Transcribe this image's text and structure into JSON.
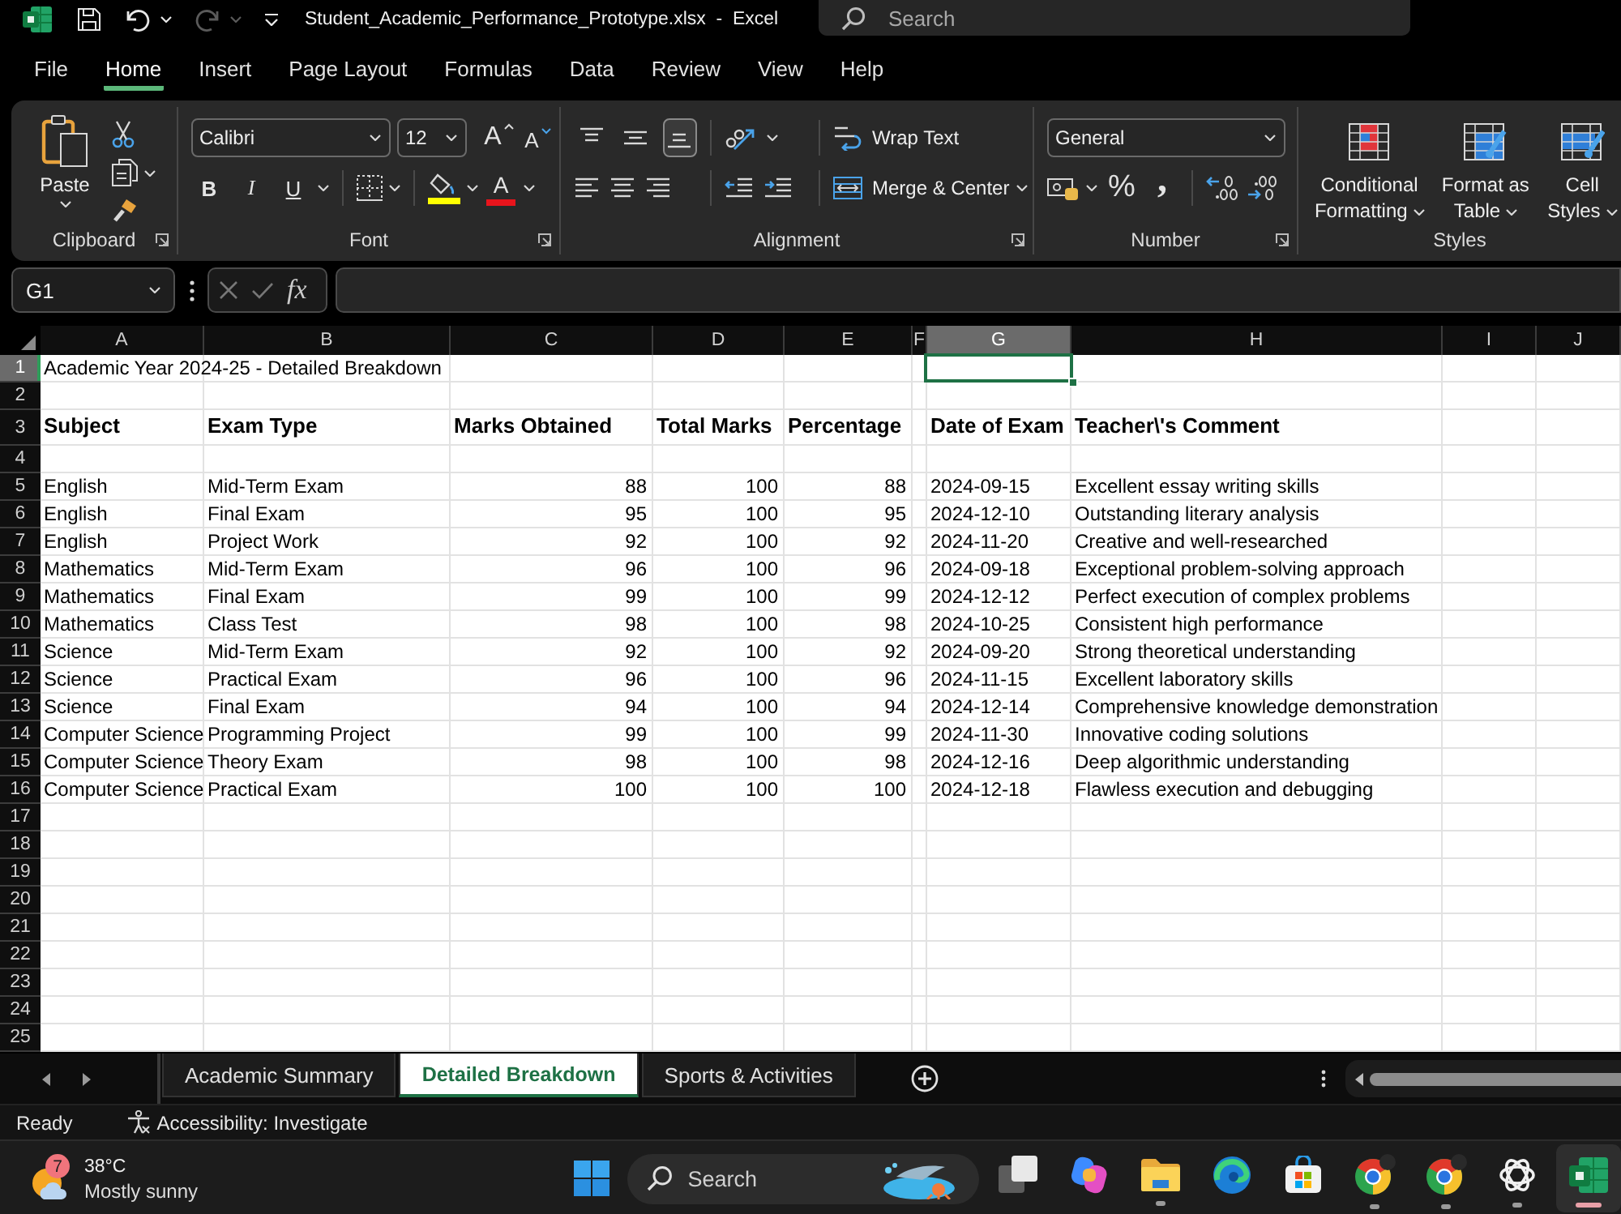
{
  "title_bar": {
    "quick_access": [
      {
        "kind": "save",
        "disabled": false
      },
      {
        "kind": "undo",
        "disabled": false
      },
      {
        "kind": "redo",
        "disabled": true
      },
      {
        "kind": "customize",
        "disabled": false
      }
    ],
    "title": "Student_Academic_Performance_Prototype.xlsx  -  Excel",
    "search": {
      "placeholder": "Search"
    }
  },
  "menu_tabs": [
    {
      "label": "File",
      "selected": false
    },
    {
      "label": "Home",
      "selected": true
    },
    {
      "label": "Insert",
      "selected": false
    },
    {
      "label": "Page Layout",
      "selected": false
    },
    {
      "label": "Formulas",
      "selected": false
    },
    {
      "label": "Data",
      "selected": false
    },
    {
      "label": "Review",
      "selected": false
    },
    {
      "label": "View",
      "selected": false
    },
    {
      "label": "Help",
      "selected": false
    }
  ],
  "ribbon": {
    "clipboard": {
      "label": "Clipboard",
      "paste": "Paste"
    },
    "font": {
      "label": "Font",
      "font_name": "Calibri",
      "font_size": "12",
      "grow_font": "A",
      "shrink_font": "A",
      "style_buttons": [
        {
          "kind": "bold",
          "glyph": "B"
        },
        {
          "kind": "italic",
          "glyph": "I"
        },
        {
          "kind": "underline",
          "glyph": "U"
        }
      ],
      "font_color": "A"
    },
    "alignment": {
      "label": "Alignment",
      "vertical": [
        {
          "kind": "top",
          "selected": false
        },
        {
          "kind": "middle",
          "selected": false
        },
        {
          "kind": "bottom",
          "selected": true
        }
      ],
      "wrap_text": "Wrap Text",
      "merge_center": "Merge & Center"
    },
    "number": {
      "label": "Number",
      "format": "General",
      "percent": "%",
      "comma": ","
    },
    "styles": {
      "label": "Styles",
      "buttons": [
        {
          "kind": "conditional",
          "label": "Conditional Formatting"
        },
        {
          "kind": "table",
          "label": "Format as Table"
        },
        {
          "kind": "cell",
          "label": "Cell Styles"
        }
      ]
    }
  },
  "formula_bar": {
    "name_box": "G1",
    "function": "fx"
  },
  "sheet": {
    "columns": [
      {
        "label": "A",
        "kind": "text",
        "selected": false
      },
      {
        "label": "B",
        "kind": "text",
        "selected": false
      },
      {
        "label": "C",
        "kind": "number",
        "selected": false
      },
      {
        "label": "D",
        "kind": "number",
        "selected": false
      },
      {
        "label": "E",
        "kind": "number",
        "selected": false
      },
      {
        "label": "F",
        "kind": "text",
        "selected": false
      },
      {
        "label": "G",
        "kind": "text",
        "selected": true
      },
      {
        "label": "H",
        "kind": "text",
        "selected": false
      },
      {
        "label": "I",
        "kind": "text",
        "selected": false
      },
      {
        "label": "J",
        "kind": "text",
        "selected": false
      }
    ],
    "rows": [
      {
        "number": "1",
        "kind": "title",
        "selected": true,
        "cells": [
          "Academic Year 2024-25 - Detailed Breakdown"
        ]
      },
      {
        "number": "2",
        "kind": "blank",
        "selected": false
      },
      {
        "number": "3",
        "kind": "header",
        "selected": false,
        "cells": [
          "Subject",
          "Exam Type",
          "Marks Obtained",
          "Total Marks",
          "Percentage",
          null,
          "Date of Exam",
          "Teacher\\'s Comment"
        ]
      },
      {
        "number": "4",
        "kind": "blank",
        "selected": false
      },
      {
        "number": "5",
        "kind": "data",
        "selected": false,
        "cells": [
          "English",
          "Mid-Term Exam",
          "88",
          "100",
          "88",
          null,
          "2024-09-15",
          "Excellent essay writing skills"
        ]
      },
      {
        "number": "6",
        "kind": "data",
        "selected": false,
        "cells": [
          "English",
          "Final Exam",
          "95",
          "100",
          "95",
          null,
          "2024-12-10",
          "Outstanding literary analysis"
        ]
      },
      {
        "number": "7",
        "kind": "data",
        "selected": false,
        "cells": [
          "English",
          "Project Work",
          "92",
          "100",
          "92",
          null,
          "2024-11-20",
          "Creative and well-researched"
        ]
      },
      {
        "number": "8",
        "kind": "data",
        "selected": false,
        "cells": [
          "Mathematics",
          "Mid-Term Exam",
          "96",
          "100",
          "96",
          null,
          "2024-09-18",
          "Exceptional problem-solving approach"
        ]
      },
      {
        "number": "9",
        "kind": "data",
        "selected": false,
        "cells": [
          "Mathematics",
          "Final Exam",
          "99",
          "100",
          "99",
          null,
          "2024-12-12",
          "Perfect execution of complex problems"
        ]
      },
      {
        "number": "10",
        "kind": "data",
        "selected": false,
        "cells": [
          "Mathematics",
          "Class Test",
          "98",
          "100",
          "98",
          null,
          "2024-10-25",
          "Consistent high performance"
        ]
      },
      {
        "number": "11",
        "kind": "data",
        "selected": false,
        "cells": [
          "Science",
          "Mid-Term Exam",
          "92",
          "100",
          "92",
          null,
          "2024-09-20",
          "Strong theoretical understanding"
        ]
      },
      {
        "number": "12",
        "kind": "data",
        "selected": false,
        "cells": [
          "Science",
          "Practical Exam",
          "96",
          "100",
          "96",
          null,
          "2024-11-15",
          "Excellent laboratory skills"
        ]
      },
      {
        "number": "13",
        "kind": "data",
        "selected": false,
        "cells": [
          "Science",
          "Final Exam",
          "94",
          "100",
          "94",
          null,
          "2024-12-14",
          "Comprehensive knowledge demonstration"
        ]
      },
      {
        "number": "14",
        "kind": "data",
        "selected": false,
        "cells": [
          "Computer Science",
          "Programming Project",
          "99",
          "100",
          "99",
          null,
          "2024-11-30",
          "Innovative coding solutions"
        ]
      },
      {
        "number": "15",
        "kind": "data",
        "selected": false,
        "cells": [
          "Computer Science",
          "Theory Exam",
          "98",
          "100",
          "98",
          null,
          "2024-12-16",
          "Deep algorithmic understanding"
        ]
      },
      {
        "number": "16",
        "kind": "data",
        "selected": false,
        "cells": [
          "Computer Science",
          "Practical Exam",
          "100",
          "100",
          "100",
          null,
          "2024-12-18",
          "Flawless execution and debugging"
        ]
      },
      {
        "number": "17",
        "kind": "blank",
        "selected": false
      },
      {
        "number": "18",
        "kind": "blank",
        "selected": false
      },
      {
        "number": "19",
        "kind": "blank",
        "selected": false
      },
      {
        "number": "20",
        "kind": "blank",
        "selected": false
      },
      {
        "number": "21",
        "kind": "blank",
        "selected": false
      },
      {
        "number": "22",
        "kind": "blank",
        "selected": false
      },
      {
        "number": "23",
        "kind": "blank",
        "selected": false
      },
      {
        "number": "24",
        "kind": "blank",
        "selected": false
      },
      {
        "number": "25",
        "kind": "blank",
        "selected": false
      }
    ]
  },
  "sheet_tabs": [
    {
      "label": "Academic Summary",
      "selected": false
    },
    {
      "label": "Detailed Breakdown",
      "selected": true
    },
    {
      "label": "Sports & Activities",
      "selected": false
    }
  ],
  "status_bar": {
    "status": "Ready",
    "accessibility": "Accessibility: Investigate"
  },
  "taskbar": {
    "weather": {
      "badge": "7",
      "temperature": "38°C",
      "condition": "Mostly sunny"
    },
    "search": {
      "placeholder": "Search"
    },
    "apps": [
      {
        "kind": "task-view",
        "running": false,
        "selected": false
      },
      {
        "kind": "copilot",
        "running": false,
        "selected": false
      },
      {
        "kind": "folder",
        "running": true,
        "selected": false
      },
      {
        "kind": "edge",
        "running": false,
        "selected": false
      },
      {
        "kind": "store",
        "running": false,
        "selected": false
      },
      {
        "kind": "chrome",
        "running": true,
        "selected": false
      },
      {
        "kind": "chrome",
        "running": true,
        "selected": false
      },
      {
        "kind": "chatgpt",
        "running": true,
        "selected": false
      },
      {
        "kind": "excel",
        "running": true,
        "selected": true
      }
    ]
  }
}
